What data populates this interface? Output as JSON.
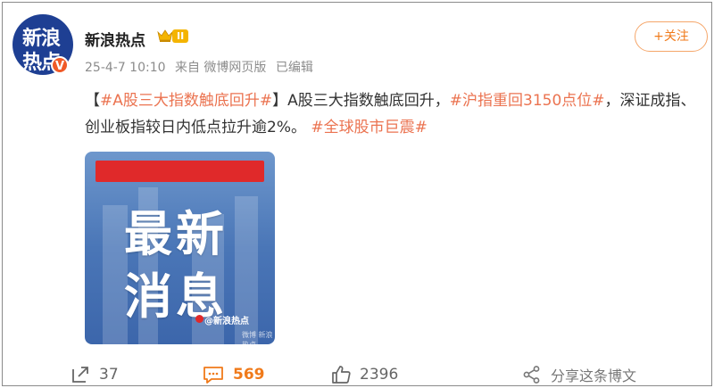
{
  "post": {
    "avatar": {
      "line1": "新浪",
      "line2": "热点",
      "badge": "V"
    },
    "username": "新浪热点",
    "level_badge": "II",
    "meta": {
      "timestamp": "25-4-7 10:10",
      "source": "来自 微博网页版",
      "edited": "已编辑"
    },
    "follow_label": "+关注",
    "text": {
      "bracket_open": "【",
      "tag1": "#A股三大指数触底回升#",
      "bracket_close": "】",
      "seg1": "A股三大指数触底回升，",
      "tag2": "#沪指重回3150点位#",
      "seg2": "，深证成指、创业板指较日内低点拉升逾2%。 ",
      "tag3": "#全球股市巨震#"
    },
    "image": {
      "line1": "最新",
      "line2": "消息",
      "credit": "@新浪热点",
      "watermark": "微博 新浪热点"
    }
  },
  "actions": {
    "repost_count": "37",
    "comment_count": "569",
    "like_count": "2396",
    "share_label": "分享这条博文"
  },
  "colors": {
    "accent": "#f07a1a",
    "tag": "#eb7350",
    "avatar_bg": "#1e3f93",
    "image_red": "#e0292a"
  },
  "icons": [
    "crown-icon",
    "repost-icon",
    "comment-icon",
    "like-icon",
    "share-icon"
  ]
}
